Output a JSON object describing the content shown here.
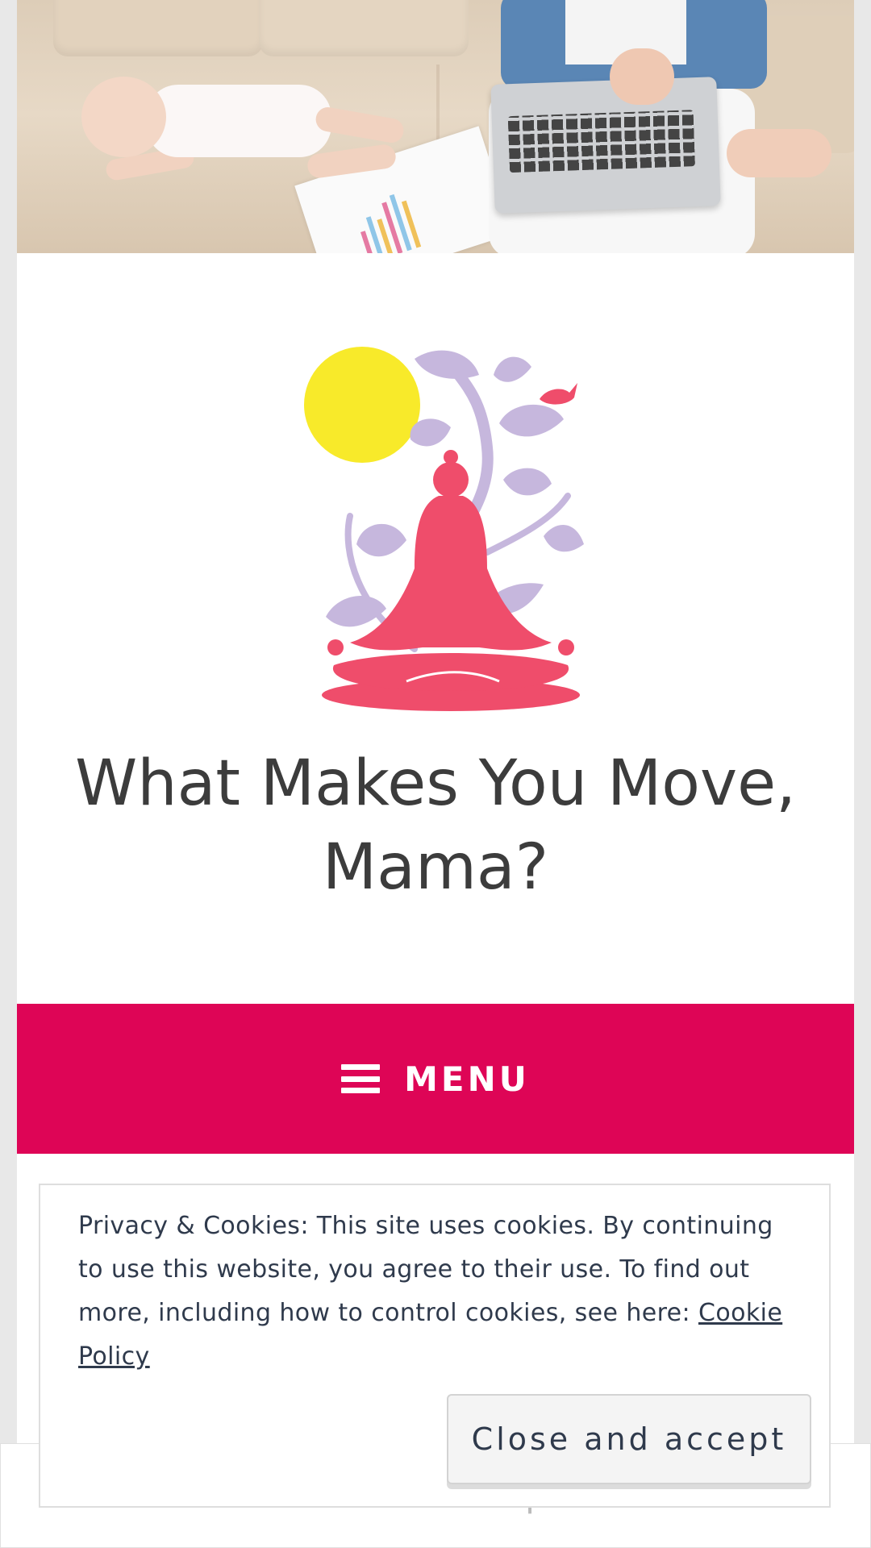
{
  "site": {
    "title": "What Makes You Move, Mama?"
  },
  "header": {
    "image_alt": "mother working on laptop beside sleeping baby on sofa"
  },
  "menu": {
    "label": "MENU",
    "icon": "hamburger-icon",
    "color": "#de0556"
  },
  "cookie_banner": {
    "text": "Privacy & Cookies: This site uses cookies. By continuing to use this website, you agree to their use. To find out more, including how to control cookies, see here: ",
    "link_label": "Cookie Policy",
    "accept_label": "Close and accept"
  },
  "colors": {
    "accent": "#de0556",
    "sun": "#f8ea2a",
    "figure": "#ef4d6b",
    "leaves": "#c6b7dd"
  }
}
